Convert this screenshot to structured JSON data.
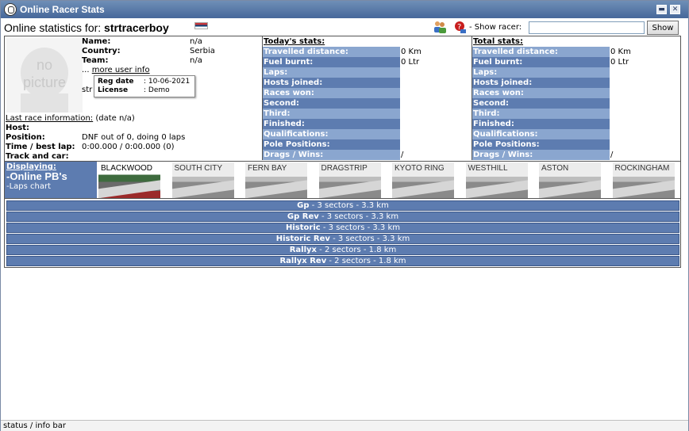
{
  "window": {
    "title": "Online Racer Stats",
    "btn_minimize": "▬",
    "btn_close": "✕"
  },
  "header": {
    "label": "Online statistics for:",
    "racer": "strtracerboy",
    "show_label": "- Show racer:",
    "show_input_value": "",
    "show_button": "Show"
  },
  "profile": {
    "picture_line1": "no",
    "picture_line2": "picture",
    "name_label": "Name:",
    "name_value": "n/a",
    "country_label": "Country:",
    "country_value": "Serbia",
    "team_label": "Team:",
    "team_value": "n/a",
    "more_prefix": "...",
    "more_link": "more user info",
    "tooltip": {
      "reg_label": "Reg date",
      "reg_value": ": 10-06-2021",
      "license_label": "License",
      "license_value": ": Demo"
    },
    "partial_text": "str"
  },
  "last_race": {
    "link": "Last race information:",
    "date": "(date n/a)",
    "host_label": "Host:",
    "host_value": "",
    "position_label": "Position:",
    "position_value": "DNF out of 0, doing 0 laps",
    "time_label": "Time / best lap:",
    "time_value": "0:00.000 / 0:00.000 (0)",
    "track_label": "Track and car:",
    "track_value": ""
  },
  "today": {
    "title": "Today's stats:",
    "rows": [
      {
        "label": "Travelled distance:",
        "value": "0 Km"
      },
      {
        "label": "Fuel burnt:",
        "value": "0 Ltr"
      },
      {
        "label": "Laps:",
        "value": ""
      },
      {
        "label": "Hosts joined:",
        "value": ""
      },
      {
        "label": "Races won:",
        "value": ""
      },
      {
        "label": "Second:",
        "value": ""
      },
      {
        "label": "Third:",
        "value": ""
      },
      {
        "label": "Finished:",
        "value": ""
      },
      {
        "label": "Qualifications:",
        "value": ""
      },
      {
        "label": "Pole Positions:",
        "value": ""
      },
      {
        "label": "Drags / Wins:",
        "value": "/"
      }
    ]
  },
  "total": {
    "title": "Total stats:",
    "rows": [
      {
        "label": "Travelled distance:",
        "value": "0 Km"
      },
      {
        "label": "Fuel burnt:",
        "value": "0 Ltr"
      },
      {
        "label": "Laps:",
        "value": ""
      },
      {
        "label": "Hosts joined:",
        "value": ""
      },
      {
        "label": "Races won:",
        "value": ""
      },
      {
        "label": "Second:",
        "value": ""
      },
      {
        "label": "Third:",
        "value": ""
      },
      {
        "label": "Finished:",
        "value": ""
      },
      {
        "label": "Qualifications:",
        "value": ""
      },
      {
        "label": "Pole Positions:",
        "value": ""
      },
      {
        "label": "Drags / Wins:",
        "value": "/"
      }
    ]
  },
  "displaying": {
    "label": "Displaying:",
    "option1": "-Online PB's",
    "option2": "-Laps chart"
  },
  "tracks": [
    "BLACKWOOD",
    "SOUTH CITY",
    "FERN BAY",
    "DRAGSTRIP",
    "KYOTO RING",
    "WESTHILL",
    "ASTON",
    "ROCKINGHAM"
  ],
  "configs": [
    {
      "name": "Gp",
      "detail": " - 3 sectors - 3.3 km"
    },
    {
      "name": "Gp Rev",
      "detail": " - 3 sectors - 3.3 km"
    },
    {
      "name": "Historic",
      "detail": " - 3 sectors - 3.3 km"
    },
    {
      "name": "Historic Rev",
      "detail": " - 3 sectors - 3.3 km"
    },
    {
      "name": "Rallyx",
      "detail": " - 2 sectors - 1.8 km"
    },
    {
      "name": "Rallyx Rev",
      "detail": " - 2 sectors - 1.8 km"
    }
  ],
  "statusbar": "status / info bar",
  "colors": {
    "accent": "#5d7cb0",
    "row_dark": "#5d7cb0",
    "row_light": "#8aa6cf"
  },
  "icons": [
    "app-icon",
    "people-icon",
    "help-icon",
    "flag-serbia"
  ]
}
